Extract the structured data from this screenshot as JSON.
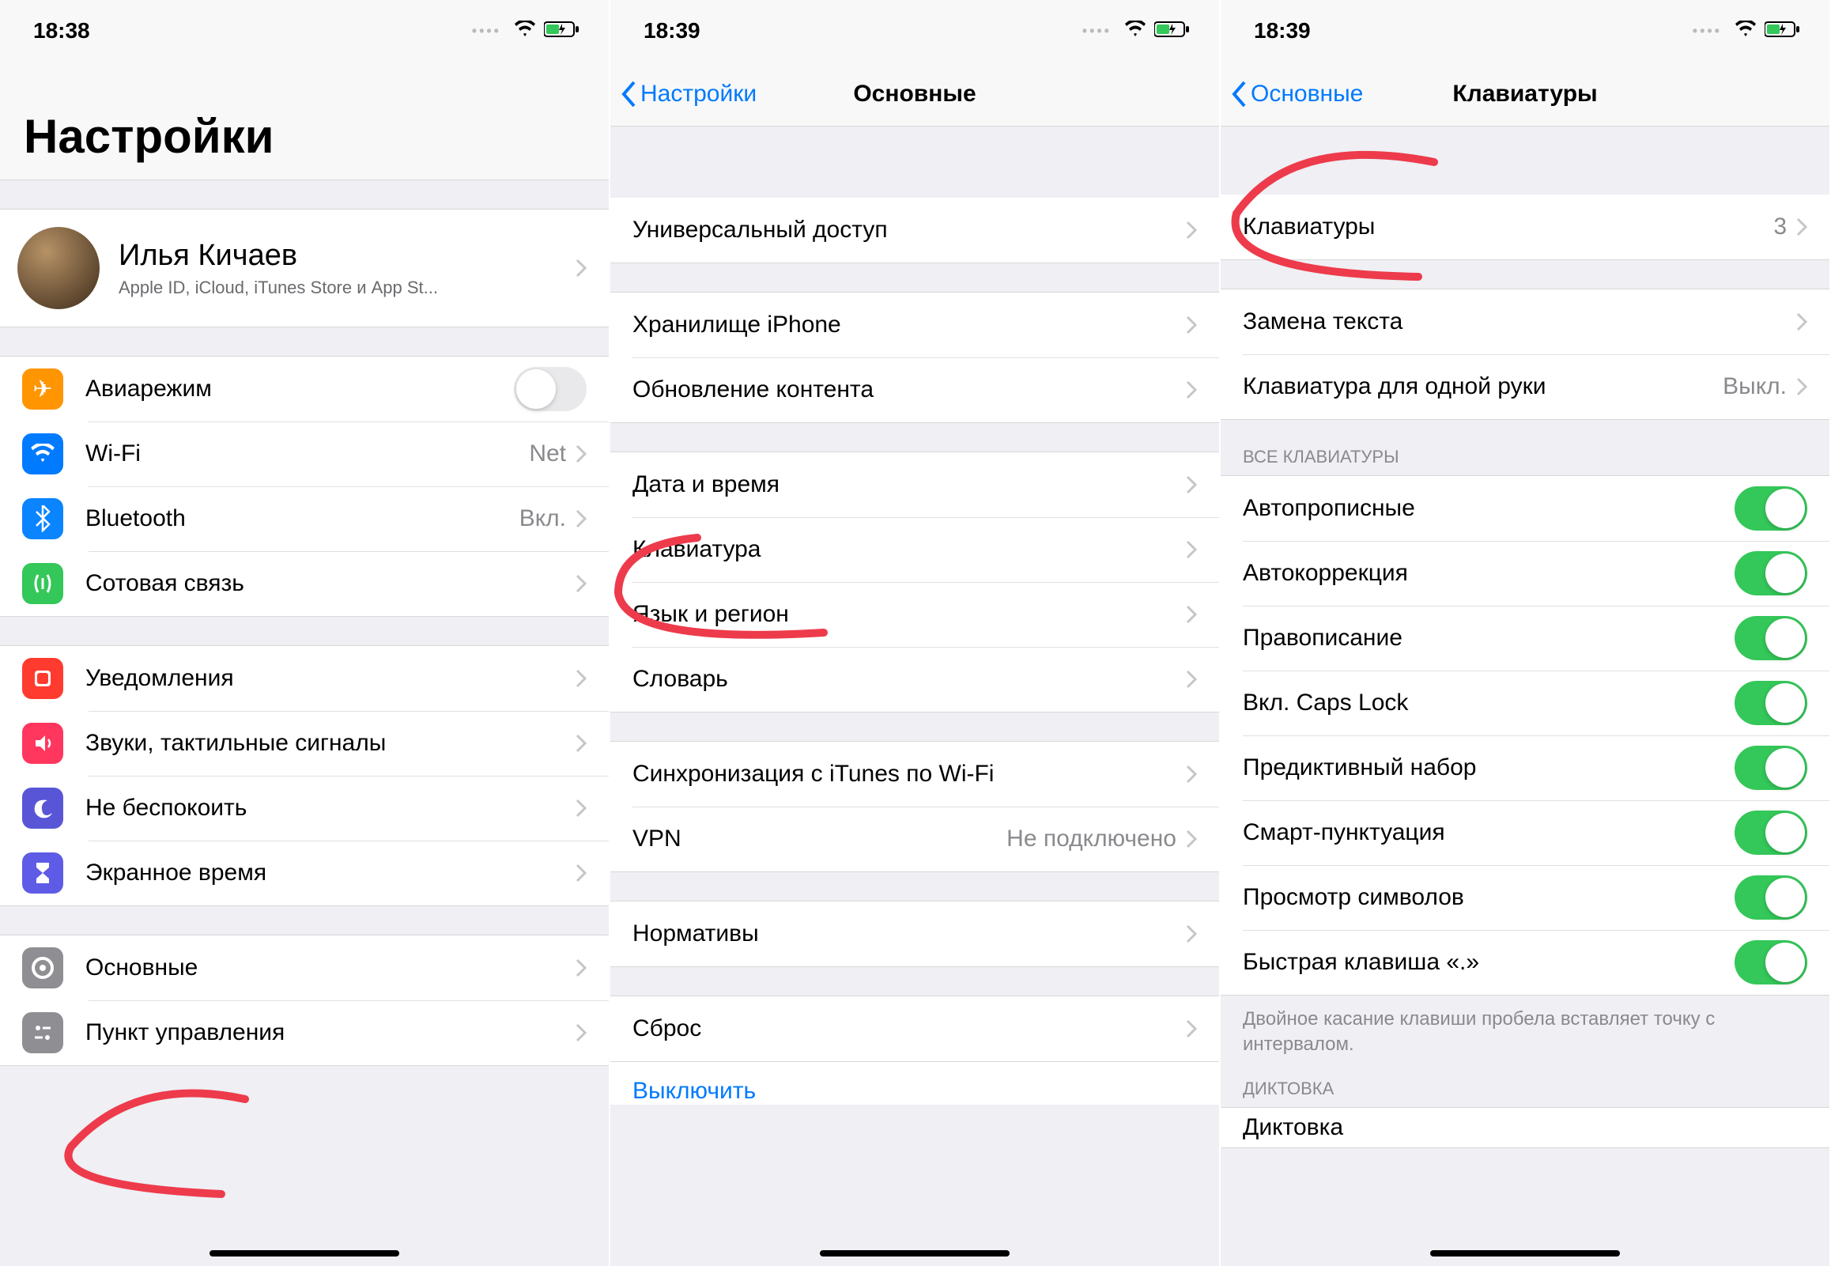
{
  "screen1": {
    "time": "18:38",
    "title": "Настройки",
    "profile": {
      "name": "Илья Кичаев",
      "sub": "Apple ID, iCloud, iTunes Store и App St..."
    },
    "airplane": "Авиарежим",
    "wifi": {
      "label": "Wi-Fi",
      "value": "Net"
    },
    "bluetooth": {
      "label": "Bluetooth",
      "value": "Вкл."
    },
    "cellular": "Сотовая связь",
    "notifications": "Уведомления",
    "sounds": "Звуки, тактильные сигналы",
    "dnd": "Не беспокоить",
    "screentime": "Экранное время",
    "general": "Основные",
    "control": "Пункт управления"
  },
  "screen2": {
    "time": "18:39",
    "back": "Настройки",
    "title": "Основные",
    "accessibility": "Универсальный доступ",
    "storage": "Хранилище iPhone",
    "background": "Обновление контента",
    "datetime": "Дата и время",
    "keyboard": "Клавиатура",
    "language": "Язык и регион",
    "dictionary": "Словарь",
    "itunes": "Синхронизация с iTunes по Wi-Fi",
    "vpn": {
      "label": "VPN",
      "value": "Не подключено"
    },
    "regulatory": "Нормативы",
    "reset": "Сброс",
    "shutdown": "Выключить"
  },
  "screen3": {
    "time": "18:39",
    "back": "Основные",
    "title": "Клавиатуры",
    "keyboards": {
      "label": "Клавиатуры",
      "value": "3"
    },
    "textreplace": "Замена текста",
    "onehand": {
      "label": "Клавиатура для одной руки",
      "value": "Выкл."
    },
    "section_all": "ВСЕ КЛАВИАТУРЫ",
    "autocap": "Автопрописные",
    "autocorrect": "Автокоррекция",
    "spell": "Правописание",
    "capslock": "Вкл. Caps Lock",
    "predictive": "Предиктивный набор",
    "smartpunct": "Смарт-пунктуация",
    "preview": "Просмотр символов",
    "shortcut": "Быстрая клавиша «.»",
    "footer": "Двойное касание клавиши пробела вставляет точку с интервалом.",
    "section_dict": "ДИКТОВКА",
    "dictation": "Диктовка"
  }
}
